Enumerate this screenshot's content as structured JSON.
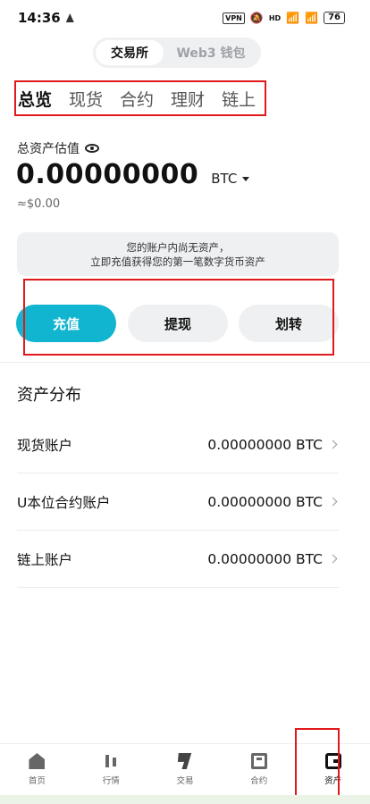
{
  "status_bar": {
    "time": "14:36",
    "vpn_label": "VPN",
    "network_label": "HD",
    "battery_level": "76"
  },
  "mode_switch": {
    "exchange_label": "交易所",
    "web3_label": "Web3 钱包"
  },
  "asset_tabs": [
    "总览",
    "现货",
    "合约",
    "理财",
    "链上"
  ],
  "summary": {
    "est_label": "总资产估值",
    "balance": "0.00000000",
    "unit": "BTC",
    "fiat": "≈$0.00"
  },
  "notice": {
    "line1": "您的账户内尚无资产，",
    "line2": "立即充值获得您的第一笔数字货币资产"
  },
  "actions": {
    "deposit": "充值",
    "withdraw": "提现",
    "transfer": "划转"
  },
  "distribution": {
    "title": "资产分布",
    "accounts": [
      {
        "name": "现货账户",
        "value": "0.00000000 BTC"
      },
      {
        "name": "U本位合约账户",
        "value": "0.00000000 BTC"
      },
      {
        "name": "链上账户",
        "value": "0.00000000 BTC"
      }
    ]
  },
  "bottom_nav": [
    {
      "label": "首页",
      "icon": "home-icon"
    },
    {
      "label": "行情",
      "icon": "market-icon"
    },
    {
      "label": "交易",
      "icon": "trade-icon"
    },
    {
      "label": "合约",
      "icon": "futures-icon"
    },
    {
      "label": "资产",
      "icon": "assets-icon"
    }
  ],
  "colors": {
    "accent": "#11b5cf",
    "highlight_frame": "#e0191b"
  }
}
